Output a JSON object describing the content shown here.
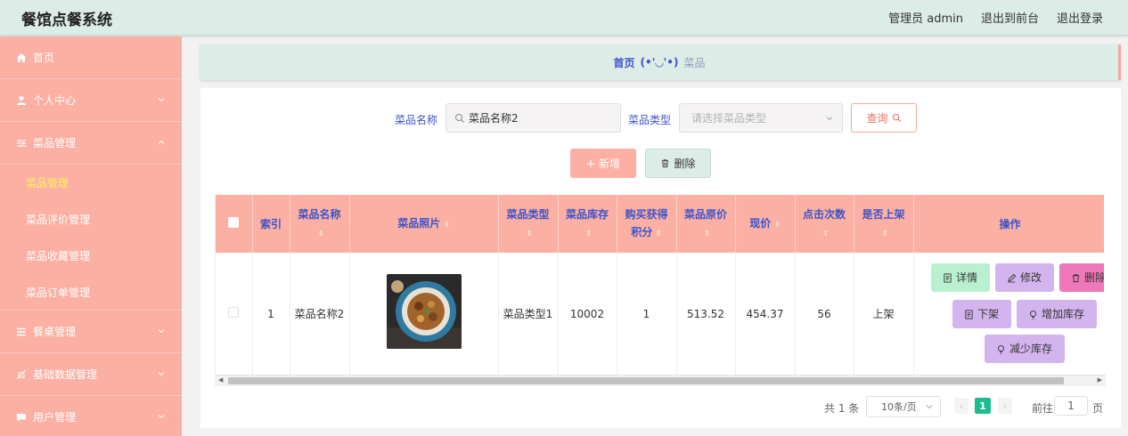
{
  "header": {
    "title": "餐馆点餐系统",
    "admin_label": "管理员 admin",
    "exit_front": "退出到前台",
    "logout": "退出登录"
  },
  "sidebar": {
    "items": [
      {
        "label": "首页",
        "icon": "home-icon"
      },
      {
        "label": "个人中心",
        "icon": "user-icon"
      },
      {
        "label": "菜品管理",
        "icon": "sliders-icon"
      },
      {
        "label": "餐桌管理",
        "icon": "list-icon"
      },
      {
        "label": "基础数据管理",
        "icon": "bell-off-icon"
      },
      {
        "label": "用户管理",
        "icon": "chat-icon"
      }
    ],
    "submenu": [
      "菜品管理",
      "菜品评价管理",
      "菜品收藏管理",
      "菜品订单管理"
    ],
    "active_color": "#fff15a"
  },
  "breadcrumb": {
    "home": "首页",
    "separator": "(•'◡'•)",
    "current": "菜品"
  },
  "search": {
    "name_label": "菜品名称",
    "name_value": "菜品名称2",
    "type_label": "菜品类型",
    "type_placeholder": "请选择菜品类型",
    "query_button": "查询"
  },
  "actions": {
    "add": "新增",
    "delete": "删除"
  },
  "table": {
    "headers": [
      "索引",
      "菜品名称",
      "菜品照片",
      "菜品类型",
      "菜品库存",
      "购买获得积分",
      "菜品原价",
      "现价",
      "点击次数",
      "是否上架",
      "操作"
    ],
    "rows": [
      {
        "index": "1",
        "name": "菜品名称2",
        "type": "菜品类型1",
        "stock": "10002",
        "points": "1",
        "original_price": "513.52",
        "price": "454.37",
        "clicks": "56",
        "on_sale": "上架"
      }
    ],
    "ops": {
      "detail": "详情",
      "edit": "修改",
      "delete": "删除",
      "off_shelf": "下架",
      "add_stock": "增加库存",
      "reduce_stock": "减少库存"
    }
  },
  "pagination": {
    "total": "共 1 条",
    "page_size": "10条/页",
    "current_page": "1",
    "goto_label": "前往",
    "goto_value": "1",
    "page_unit": "页"
  },
  "colors": {
    "sidebar": "#fbb0a3",
    "header": "#dcece6",
    "accent_blue": "#3d53c9",
    "pager_active": "#1ebc8e"
  }
}
